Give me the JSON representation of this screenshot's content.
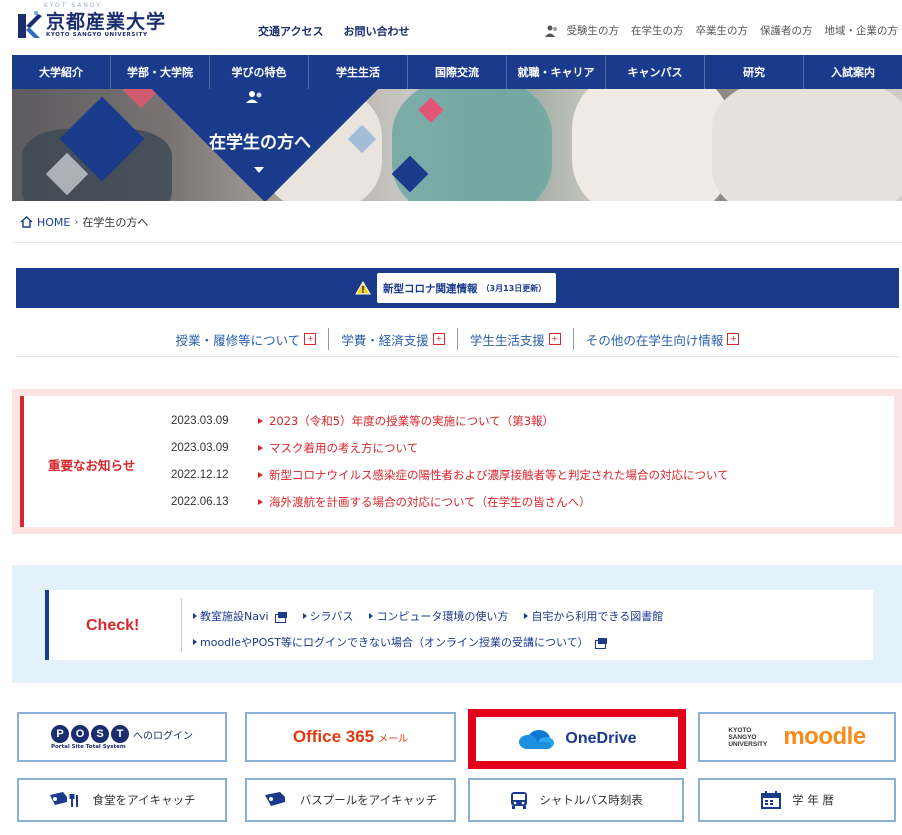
{
  "header": {
    "logo_eyebrow": "KYOT SANGY",
    "logo_name": "京都産業大学",
    "logo_en": "KYOTO SANGYO UNIVERSITY",
    "util_links": [
      "交通アクセス",
      "お問い合わせ"
    ],
    "audience_links": [
      "受験生の方",
      "在学生の方",
      "卒業生の方",
      "保護者の方",
      "地域・企業の方"
    ]
  },
  "gnav": [
    "大学紹介",
    "学部・大学院",
    "学びの特色",
    "学生生活",
    "国際交流",
    "就職・キャリア",
    "キャンパス",
    "研究",
    "入試案内"
  ],
  "hero": {
    "title": "在学生の方へ"
  },
  "breadcrumb": {
    "home": "HOME",
    "current": "在学生の方へ"
  },
  "corona": {
    "label": "新型コロナ関連情報",
    "updated": "（3月13日更新）"
  },
  "tabs": [
    "授業・履修等について",
    "学費・経済支援",
    "学生生活支援",
    "その他の在学生向け情報"
  ],
  "tab_plus": "+",
  "notice": {
    "label": "重要なお知らせ",
    "items": [
      {
        "date": "2023.03.09",
        "title": "2023（令和5）年度の授業等の実施について（第3報）"
      },
      {
        "date": "2023.03.09",
        "title": "マスク着用の考え方について"
      },
      {
        "date": "2022.12.12",
        "title": "新型コロナウイルス感染症の陽性者および濃厚接触者等と判定された場合の対応について"
      },
      {
        "date": "2022.06.13",
        "title": "海外渡航を計画する場合の対応について（在学生の皆さんへ）"
      }
    ]
  },
  "check": {
    "label": "Check!",
    "links": [
      "教室施設Navi",
      "シラバス",
      "コンピュータ環境の使い方",
      "自宅から利用できる図書館"
    ],
    "link2": "moodleやPOST等にログインできない場合（オンライン授業の受講について）"
  },
  "banners": {
    "post_letters": [
      "P",
      "O",
      "S",
      "T"
    ],
    "post_sub": "Portal Site Total System",
    "post_text": "へのログイン",
    "office_main": "Office 365",
    "office_sub": "メール",
    "onedrive": "OneDrive",
    "moodle_k1": "KYOTO",
    "moodle_k2": "SANGYO",
    "moodle_k3": "UNIVERSITY",
    "moodle_word": "moodle",
    "shokudo": "食堂をアイキャッチ",
    "bus": "バスプールをアイキャッチ",
    "shuttle": "シャトルバス時刻表",
    "calendar": "学 年 暦"
  },
  "colors": {
    "navy": "#1a3a8c",
    "red": "#d7262c",
    "highlight": "#e3001b",
    "onedrive": "#1f6fc7"
  }
}
